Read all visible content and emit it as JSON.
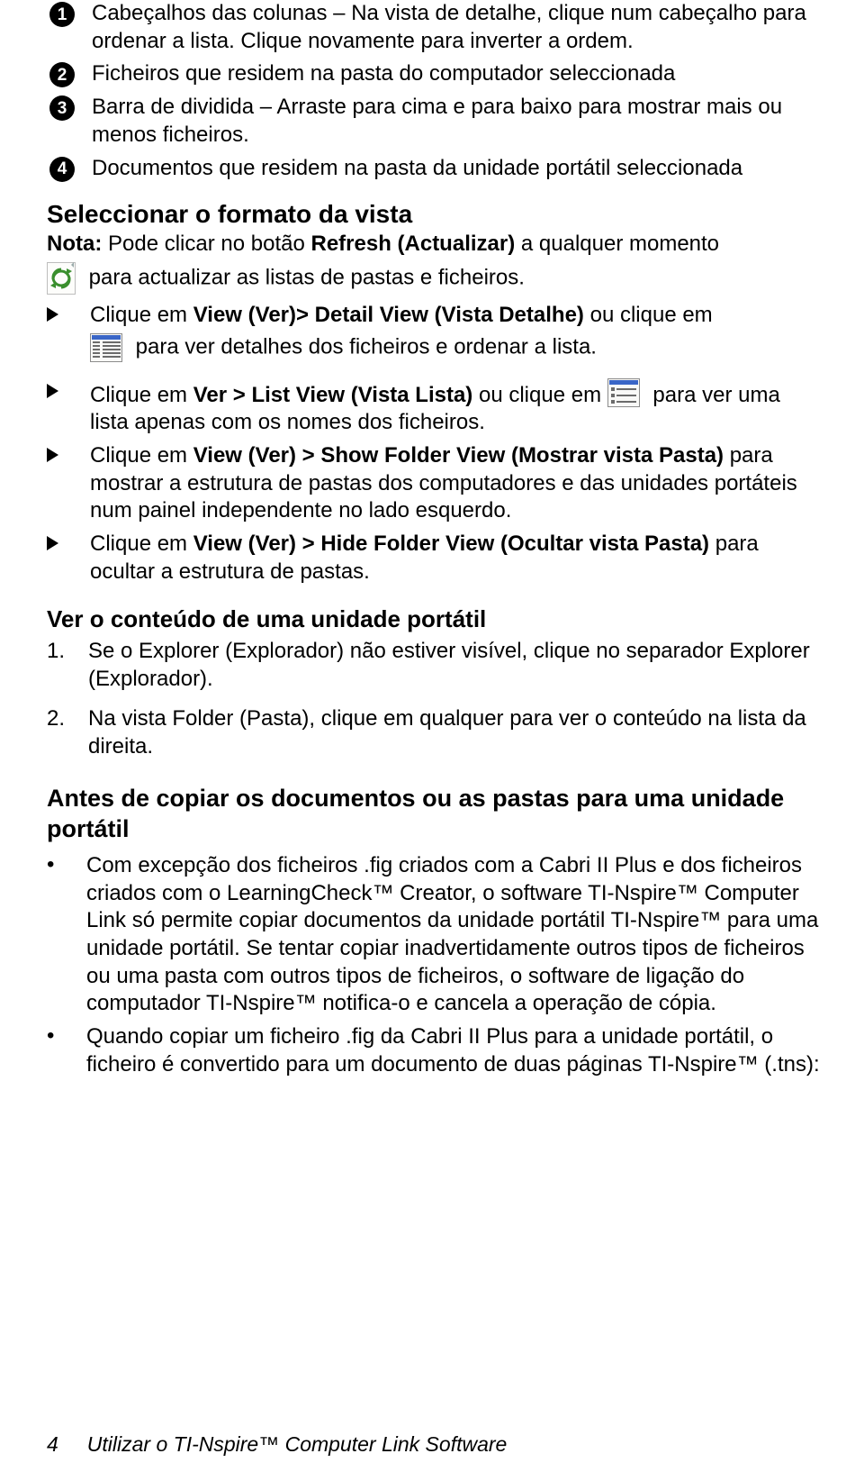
{
  "numbered": {
    "items": [
      {
        "num": "1",
        "text": "Cabeçalhos das colunas – Na vista de detalhe, clique num cabeçalho para ordenar a lista. Clique novamente para inverter a ordem."
      },
      {
        "num": "2",
        "text": "Ficheiros que residem na pasta do computador seleccionada"
      },
      {
        "num": "3",
        "text": "Barra de dividida – Arraste para cima e para baixo para mostrar mais ou menos ficheiros."
      },
      {
        "num": "4",
        "text": "Documentos que residem na pasta da unidade portátil seleccionada"
      }
    ]
  },
  "section1": {
    "title": "Seleccionar o formato da vista",
    "nota_label": "Nota:",
    "nota_pre": " Pode clicar no botão ",
    "nota_bold": "Refresh (Actualizar)",
    "nota_post": " a qualquer momento",
    "refresh_line": " para actualizar as listas de pastas e ficheiros.",
    "bullets": {
      "b1": {
        "pre": "Clique em ",
        "bold": "View (Ver)> Detail View (Vista Detalhe)",
        "post": " ou clique em ",
        "after_icon": " para ver detalhes dos ficheiros e ordenar a lista."
      },
      "b2": {
        "pre": "Clique em ",
        "bold": "Ver > List View (Vista Lista)",
        "mid": " ou clique em ",
        "post_icon": " para ver uma lista apenas com os nomes dos ficheiros."
      },
      "b3": {
        "pre": "Clique em ",
        "bold": "View (Ver) > Show Folder View (Mostrar vista Pasta)",
        "post": " para mostrar a estrutura de pastas dos computadores e das unidades portáteis num painel independente no lado esquerdo."
      },
      "b4": {
        "pre": "Clique em ",
        "bold": "View (Ver) > Hide Folder View (Ocultar vista Pasta)",
        "post": " para ocultar a estrutura de pastas."
      }
    }
  },
  "section2": {
    "title": "Ver o conteúdo de uma unidade portátil",
    "items": {
      "i1": {
        "num": "1.",
        "text": "Se o Explorer (Explorador) não estiver visível, clique no separador Explorer (Explorador)."
      },
      "i2": {
        "num": "2.",
        "text": "Na vista Folder (Pasta), clique em qualquer para ver o conteúdo na lista da direita."
      }
    }
  },
  "section3": {
    "title": "Antes de copiar os documentos ou as pastas para uma unidade portátil",
    "items": {
      "d1": "Com excepção dos ficheiros .fig criados com a Cabri II Plus e dos ficheiros criados com o LearningCheck™ Creator, o software TI-Nspire™ Computer Link só permite copiar documentos da unidade portátil TI-Nspire™ para uma unidade portátil. Se tentar copiar inadvertidamente outros tipos de ficheiros ou uma pasta com outros tipos de ficheiros, o software de ligação do computador TI-Nspire™ notifica-o e cancela a operação de cópia.",
      "d2": "Quando copiar um ficheiro .fig da Cabri II Plus para a unidade portátil, o ficheiro é convertido para um documento de duas páginas TI-Nspire™ (.tns):"
    }
  },
  "footer": {
    "page": "4",
    "title": "Utilizar o TI-Nspire™ Computer Link Software"
  },
  "dot": "•"
}
